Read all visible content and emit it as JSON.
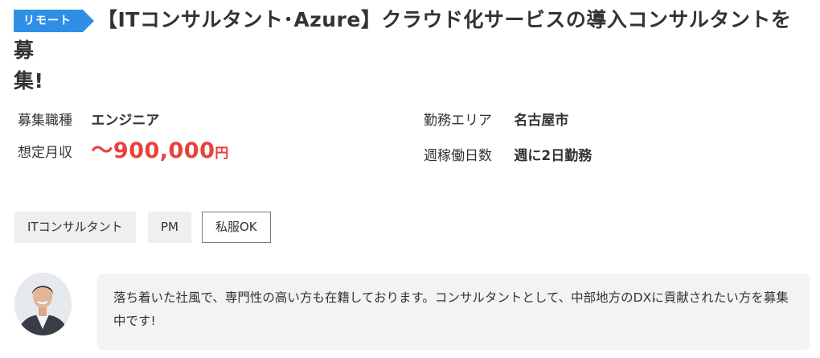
{
  "badge": {
    "label": "リモート",
    "color": "#2f8fe6"
  },
  "title": {
    "line1": "【ITコンサルタント･Azure】クラウド化サービスの導入コンサルタントを募",
    "line2": "集!"
  },
  "info": {
    "job_type_label": "募集職種",
    "job_type_value": "エンジニア",
    "salary_label": "想定月収",
    "salary_value": "〜900,000",
    "salary_unit": "円",
    "area_label": "勤務エリア",
    "area_value": "名古屋市",
    "days_label": "週稼働日数",
    "days_value": "週に2日勤務"
  },
  "tags": [
    {
      "label": "ITコンサルタント"
    },
    {
      "label": "PM"
    },
    {
      "label": "私服OK"
    }
  ],
  "message": {
    "text": "落ち着いた社風で、専門性の高い方も在籍しております。コンサルタントとして、中部地方のDXに貢献されたい方を募集中です!"
  },
  "colors": {
    "accent": "#2f8fe6",
    "salary": "#e8413b",
    "tag_bg": "#efefef",
    "bubble_bg": "#f3f3f3"
  }
}
